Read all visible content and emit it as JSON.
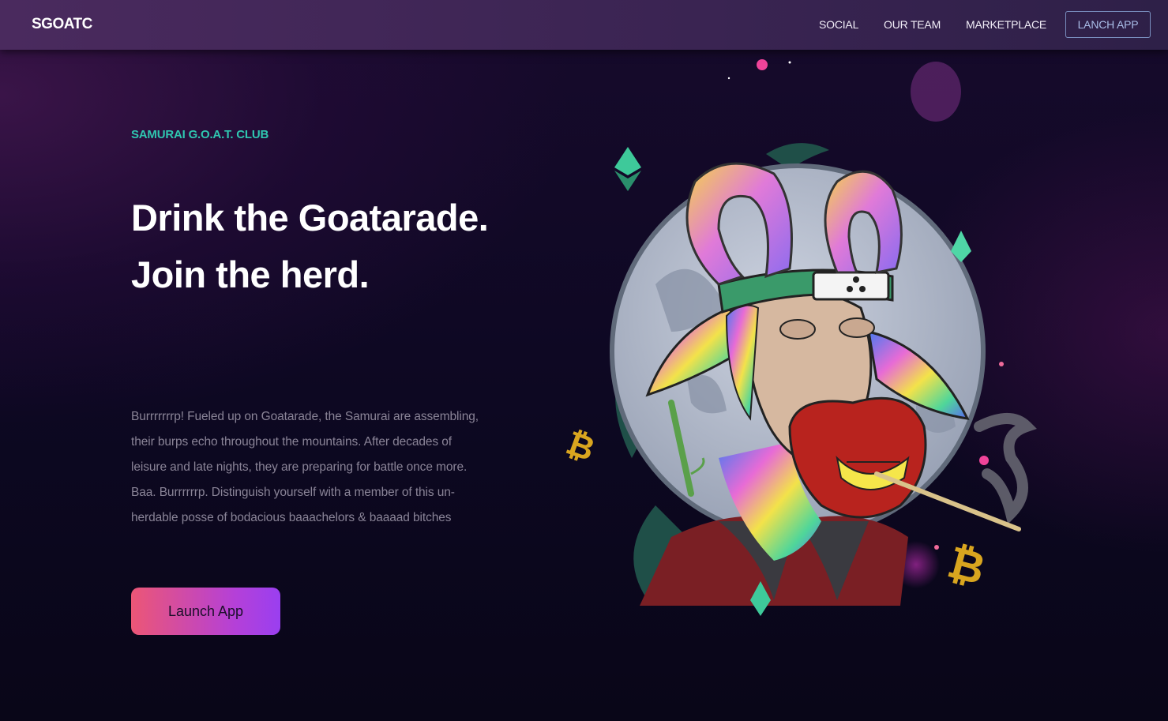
{
  "nav": {
    "logo": "SGOATC",
    "links": [
      {
        "label": "SOCIAL"
      },
      {
        "label": "OUR TEAM"
      },
      {
        "label": "MARKETPLACE"
      }
    ],
    "cta_label": "LANCH APP"
  },
  "hero": {
    "eyebrow": "SAMURAI G.O.A.T. CLUB",
    "headline": "Drink the Goatarade. Join the herd.",
    "body": "Burrrrrrrp! Fueled up on Goatarade, the Samurai are assembling, their burps echo throughout the mountains. After decades of leisure and late nights, they are preparing for battle once more. Baa. Burrrrrrp. Distinguish yourself with a member of this un-herdable posse of bodacious baaachelors & baaaad bitches",
    "cta_label": "Launch App"
  },
  "illustration": {
    "subject": "samurai-goat-illustration",
    "icons": [
      "ethereum-icon",
      "ethereum-icon",
      "ethereum-icon",
      "bitcoin-icon",
      "bitcoin-icon"
    ]
  },
  "colors": {
    "accent_teal": "#2fc7b0",
    "button_gradient_start": "#ec5676",
    "button_gradient_end": "#9a3ff0",
    "bitcoin_gold": "#d9a51f",
    "ethereum_green": "#3ec99a"
  }
}
